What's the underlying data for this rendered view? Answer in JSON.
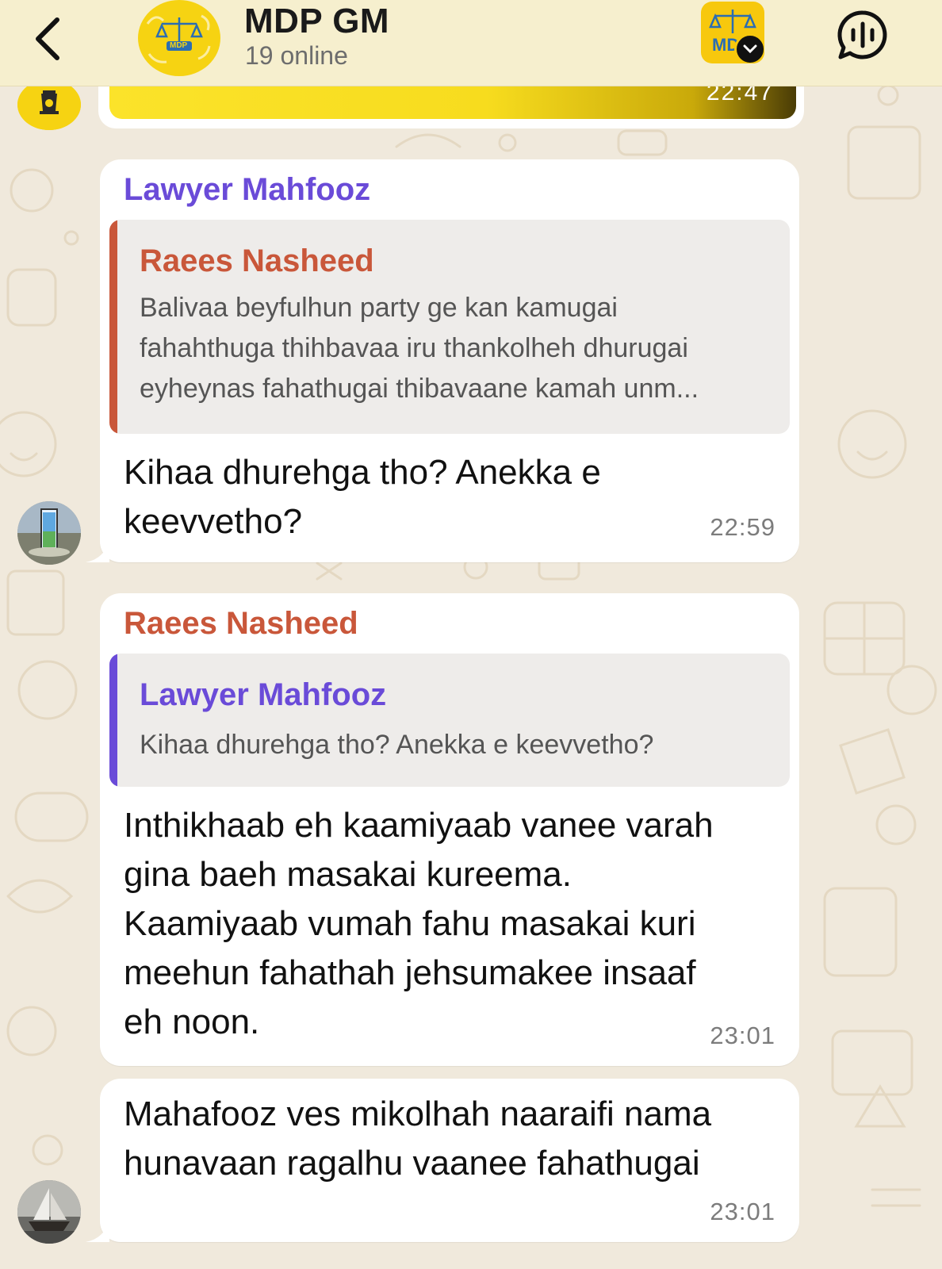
{
  "header": {
    "back_icon": "chevron-left-icon",
    "group_name": "MDP GM",
    "status": "19 online",
    "group_avatar_text": "MDP",
    "badge_text": "MD",
    "voice_icon": "voice-chat-icon"
  },
  "top_message": {
    "time": "22:47"
  },
  "messages": [
    {
      "sender": "Lawyer Mahfooz",
      "sender_color": "#6a4bd8",
      "reply": {
        "name": "Raees Nasheed",
        "name_color": "#c9573a",
        "text": "Balivaa beyfulhun party ge kan kamugai\nfahahthuga thihbavaa iru thankolheh dhurugai\neyheynas fahathugai thibavaane kamah unm..."
      },
      "text": "Kihaa dhurehga tho? Anekka e\nkeevvetho?",
      "time": "22:59"
    },
    {
      "sender": "Raees Nasheed",
      "sender_color": "#c9573a",
      "reply": {
        "name": "Lawyer Mahfooz",
        "name_color": "#6a4bd8",
        "text": "Kihaa dhurehga tho? Anekka e keevvetho?"
      },
      "text": "Inthikhaab eh kaamiyaab vanee varah\ngina baeh masakai kureema.\nKaamiyaab vumah fahu masakai kuri\nmeehun fahathah jehsumakee insaaf\neh noon.",
      "time": "23:01"
    },
    {
      "text": "Mahafooz ves mikolhah naaraifi nama\nhunavaan ragalhu vaanee fahathugai",
      "time": "23:01"
    }
  ]
}
